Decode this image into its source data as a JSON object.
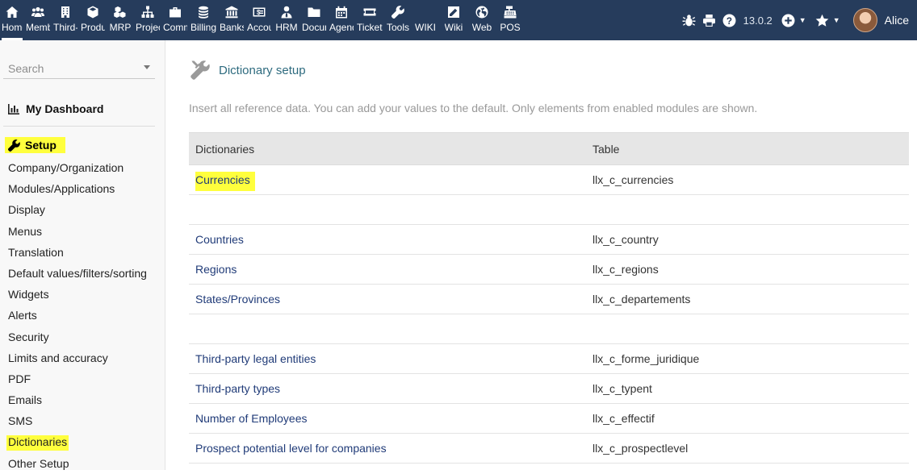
{
  "topmenu": [
    {
      "id": "home",
      "label": "Home",
      "icon": "home-icon",
      "width": 30,
      "active": true
    },
    {
      "id": "members",
      "label": "Members",
      "icon": "members-icon",
      "width": 34
    },
    {
      "id": "thirdparties",
      "label": "Third-parties",
      "icon": "building-icon",
      "width": 34
    },
    {
      "id": "products",
      "label": "Products",
      "icon": "cube-icon",
      "width": 34
    },
    {
      "id": "mrp",
      "label": "MRP",
      "icon": "cubes-icon",
      "width": 34
    },
    {
      "id": "projects",
      "label": "Projects",
      "icon": "project-icon",
      "width": 34
    },
    {
      "id": "commercial",
      "label": "Commercial",
      "icon": "briefcase-icon",
      "width": 34
    },
    {
      "id": "billing",
      "label": "Billing",
      "icon": "coins-icon",
      "width": 36
    },
    {
      "id": "banks",
      "label": "Banks",
      "icon": "bank-icon",
      "width": 34
    },
    {
      "id": "accounting",
      "label": "Accounting",
      "icon": "dollar-card-icon",
      "width": 34
    },
    {
      "id": "hrm",
      "label": "HRM",
      "icon": "user-tie-icon",
      "width": 34
    },
    {
      "id": "documents",
      "label": "Documents",
      "icon": "folder-icon",
      "width": 34
    },
    {
      "id": "agenda",
      "label": "Agenda",
      "icon": "calendar-icon",
      "width": 34
    },
    {
      "id": "tickets",
      "label": "Tickets",
      "icon": "ticket-icon",
      "width": 36
    },
    {
      "id": "tools",
      "label": "Tools",
      "icon": "wrench-icon",
      "width": 34
    },
    {
      "id": "wiki1",
      "label": "WIKI",
      "icon": "",
      "width": 34
    },
    {
      "id": "wiki2",
      "label": "Wiki",
      "icon": "edit-icon",
      "width": 36
    },
    {
      "id": "web",
      "label": "Web",
      "icon": "globe-icon",
      "width": 34
    },
    {
      "id": "pos",
      "label": "POS",
      "icon": "cash-register-icon",
      "width": 36
    }
  ],
  "topright": {
    "version": "13.0.2",
    "username": "Alice"
  },
  "sidebar": {
    "search_placeholder": "Search",
    "dashboard_label": "My Dashboard",
    "setup_label": "Setup",
    "items": [
      {
        "label": "Company/Organization"
      },
      {
        "label": "Modules/Applications"
      },
      {
        "label": "Display"
      },
      {
        "label": "Menus"
      },
      {
        "label": "Translation"
      },
      {
        "label": "Default values/filters/sorting"
      },
      {
        "label": "Widgets"
      },
      {
        "label": "Alerts"
      },
      {
        "label": "Security"
      },
      {
        "label": "Limits and accuracy"
      },
      {
        "label": "PDF"
      },
      {
        "label": "Emails"
      },
      {
        "label": "SMS"
      },
      {
        "label": "Dictionaries",
        "highlight": true
      },
      {
        "label": "Other Setup"
      }
    ]
  },
  "main": {
    "title": "Dictionary setup",
    "description": "Insert all reference data. You can add your values to the default. Only elements from enabled modules are shown.",
    "table": {
      "headers": [
        "Dictionaries",
        "Table"
      ],
      "rows": [
        {
          "name": "Currencies",
          "table": "llx_c_currencies",
          "highlight": true
        },
        {
          "empty": true
        },
        {
          "name": "Countries",
          "table": "llx_c_country"
        },
        {
          "name": "Regions",
          "table": "llx_c_regions"
        },
        {
          "name": "States/Provinces",
          "table": "llx_c_departements"
        },
        {
          "empty": true
        },
        {
          "name": "Third-party legal entities",
          "table": "llx_c_forme_juridique"
        },
        {
          "name": "Third-party types",
          "table": "llx_c_typent"
        },
        {
          "name": "Number of Employees",
          "table": "llx_c_effectif"
        },
        {
          "name": "Prospect potential level for companies",
          "table": "llx_c_prospectlevel"
        }
      ]
    }
  }
}
